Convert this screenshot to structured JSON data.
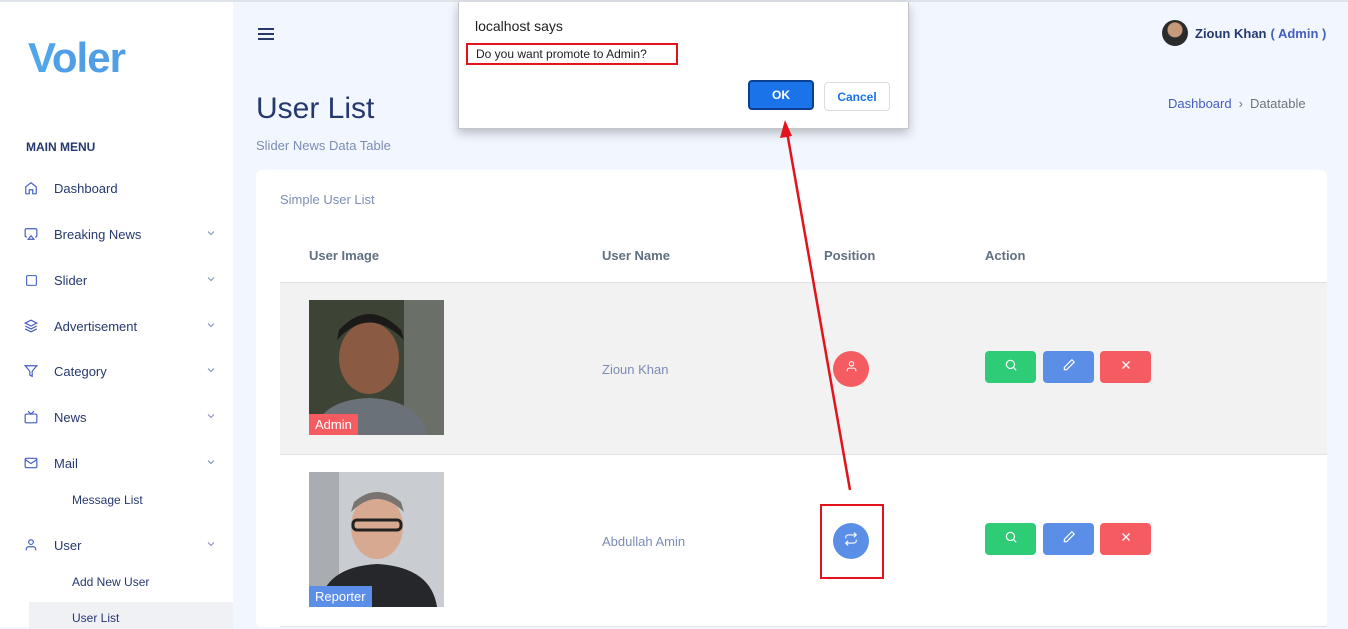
{
  "sidebar": {
    "logo": {
      "first": "V",
      "rest": "oler"
    },
    "menu_title": "MAIN MENU",
    "items": [
      {
        "label": "Dashboard",
        "icon": "home-icon",
        "has_chevron": false
      },
      {
        "label": "Breaking News",
        "icon": "airplay-icon",
        "has_chevron": true
      },
      {
        "label": "Slider",
        "icon": "square-icon",
        "has_chevron": true
      },
      {
        "label": "Advertisement",
        "icon": "layers-icon",
        "has_chevron": true
      },
      {
        "label": "Category",
        "icon": "filter-icon",
        "has_chevron": true
      },
      {
        "label": "News",
        "icon": "tv-icon",
        "has_chevron": true
      },
      {
        "label": "Mail",
        "icon": "mail-icon",
        "has_chevron": true
      },
      {
        "label": "User",
        "icon": "user-icon",
        "has_chevron": true
      }
    ],
    "mail_sub": [
      "Message List"
    ],
    "user_sub": [
      "Add New User",
      "User List"
    ]
  },
  "header": {
    "user_name": "Zioun Khan",
    "user_role": "( Admin )"
  },
  "page": {
    "title": "User List",
    "subtitle": "Slider News Data Table",
    "breadcrumb": {
      "home": "Dashboard",
      "separator": "›",
      "current": "Datatable"
    }
  },
  "card": {
    "title": "Simple User List",
    "columns": [
      "User Image",
      "User Name",
      "Position",
      "Action"
    ],
    "rows": [
      {
        "name": "Zioun Khan",
        "role": "Admin",
        "role_color": "#f55c61",
        "position_icon": "user-icon",
        "position_color": "#f55c61"
      },
      {
        "name": "Abdullah Amin",
        "role": "Reporter",
        "role_color": "#5b8ee6",
        "position_icon": "repeat-icon",
        "position_color": "#5b8ee6"
      }
    ]
  },
  "dialog": {
    "title": "localhost says",
    "message": "Do you want promote to Admin?",
    "ok_label": "OK",
    "cancel_label": "Cancel"
  },
  "colors": {
    "accent": "#435ebe",
    "annotation": "#e4121b"
  }
}
